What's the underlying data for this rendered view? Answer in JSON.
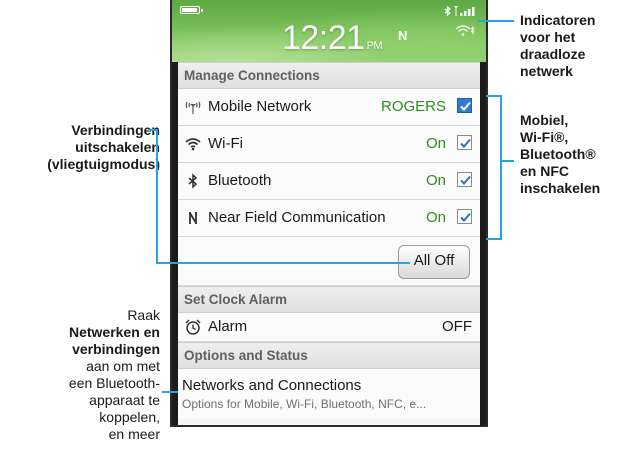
{
  "status_bar": {
    "time": "12:21",
    "ampm": "PM",
    "nfc_indicator": "N",
    "icons": [
      "battery-icon",
      "bluetooth-status-icon",
      "signal-bars-icon",
      "wifi-status-icon"
    ]
  },
  "manage_connections": {
    "header": "Manage Connections",
    "rows": [
      {
        "icon": "mobile-antenna-icon",
        "label": "Mobile Network",
        "value": "ROGERS",
        "checked": true
      },
      {
        "icon": "wifi-icon",
        "label": "Wi-Fi",
        "value": "On",
        "checked": true
      },
      {
        "icon": "bluetooth-icon",
        "label": "Bluetooth",
        "value": "On",
        "checked": true
      },
      {
        "icon": "nfc-icon",
        "label": "Near Field Communication",
        "value": "On",
        "checked": true
      }
    ],
    "all_off_button": "All Off"
  },
  "clock_alarm": {
    "header": "Set Clock Alarm",
    "label": "Alarm",
    "value": "OFF"
  },
  "options_status": {
    "header": "Options and Status",
    "title": "Networks and Connections",
    "subtitle": "Options for Mobile, Wi-Fi, Bluetooth, NFC, e..."
  },
  "annotations": {
    "top_right": {
      "line1": "Indicatoren",
      "line2": "voor het",
      "line3": "draadloze",
      "line4": "netwerk"
    },
    "mid_right": {
      "line1": "Mobiel,",
      "line2": "Wi-Fi®,",
      "line3": "Bluetooth®",
      "line4": "en NFC",
      "line5": "inschakelen"
    },
    "left_top": {
      "line1": "Verbindingen",
      "line2": "uitschakelen",
      "line3": "(vliegtuigmodus)"
    },
    "left_bottom": {
      "line1": "Raak",
      "line2": "Netwerken en",
      "line3": "verbindingen",
      "line4": "aan om met",
      "line5": "een Bluetooth-",
      "line6": "apparaat te",
      "line7": "koppelen,",
      "line8": "en meer"
    }
  },
  "colors": {
    "accent_line": "#27a4dc",
    "status_green": "#2e8b1e",
    "header_green": "#6bb84f",
    "check_blue": "#2f7bd6"
  }
}
